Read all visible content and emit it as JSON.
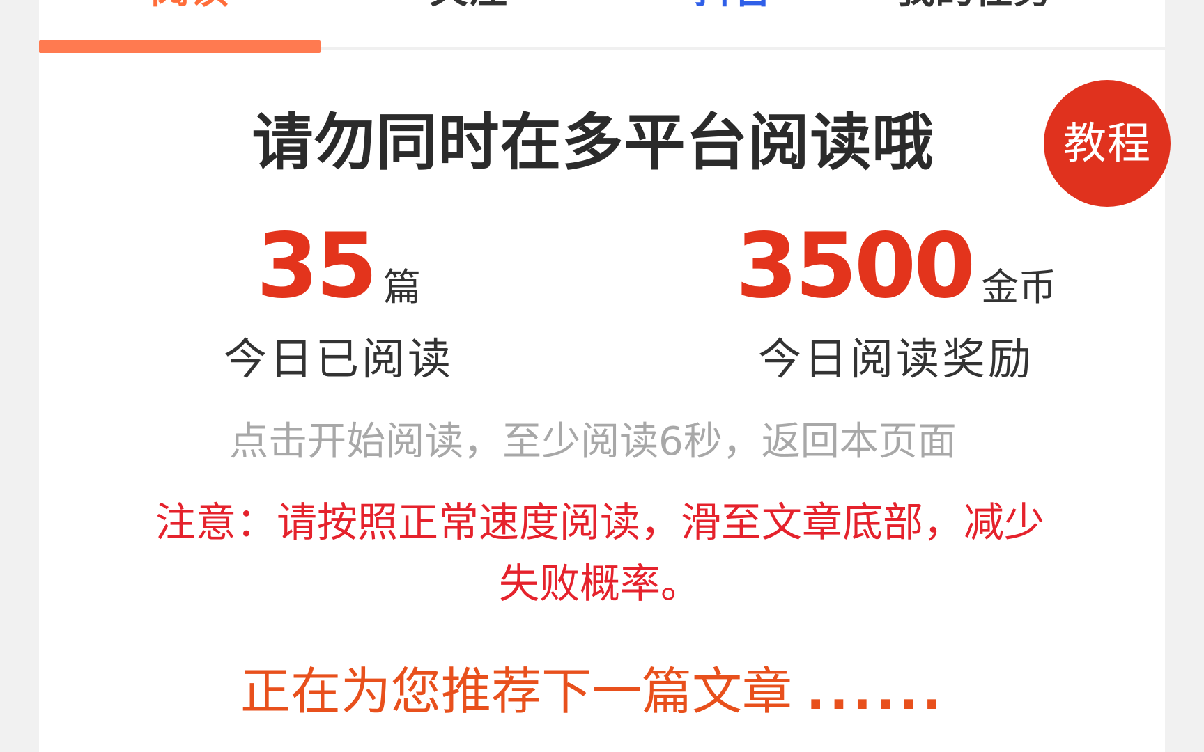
{
  "tabs": [
    {
      "label": "阅读"
    },
    {
      "label": "关注"
    },
    {
      "label": "抖音"
    },
    {
      "label": "我的任务"
    }
  ],
  "header": {
    "title": "请勿同时在多平台阅读哦",
    "tutorial_label": "教程"
  },
  "stats": {
    "read": {
      "value": "35",
      "unit": "篇",
      "label": "今日已阅读"
    },
    "reward": {
      "value": "3500",
      "unit": "金币",
      "label": "今日阅读奖励"
    }
  },
  "hint": "点击开始阅读，至少阅读6秒，返回本页面",
  "notice": "注意：请按照正常速度阅读，滑至文章底部，减少失败概率。",
  "recommend": {
    "text": "正在为您推荐下一篇文章",
    "dots": "......"
  },
  "colors": {
    "accent": "#e3341c",
    "tab_indicator": "#ff7a50",
    "notice": "#e5222c",
    "recommend": "#e8501c",
    "tutorial_bg": "#e0321e"
  }
}
